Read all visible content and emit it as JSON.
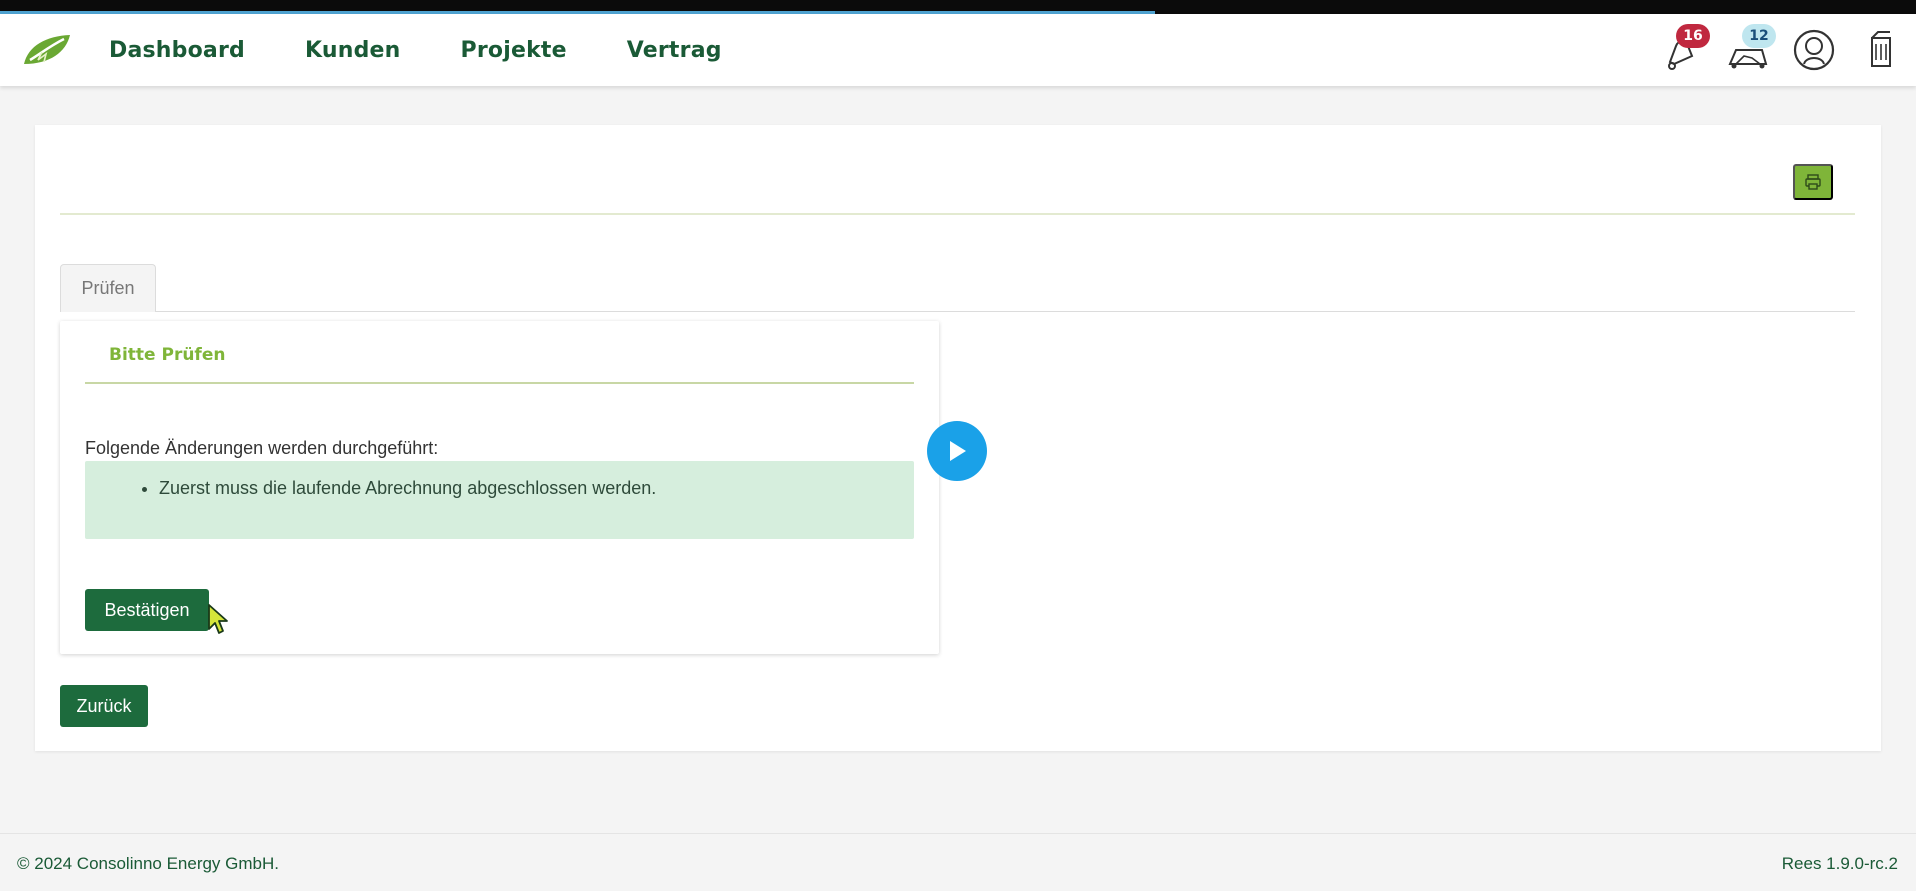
{
  "nav": {
    "items": [
      {
        "label": "Dashboard"
      },
      {
        "label": "Kunden"
      },
      {
        "label": "Projekte"
      },
      {
        "label": "Vertrag"
      }
    ],
    "icons": [
      {
        "name": "notification-bell-icon",
        "badge": "16",
        "badge_color": "#c0283f"
      },
      {
        "name": "messages-icon",
        "badge": "12",
        "badge_color": "#bfe6ef"
      },
      {
        "name": "user-profile-icon"
      },
      {
        "name": "logout-icon"
      }
    ]
  },
  "tabs": [
    {
      "label": "Prüfen"
    }
  ],
  "panel": {
    "title": "Bitte Prüfen",
    "changes_label": "Folgende Änderungen werden durchgeführt:",
    "changes": [
      "Zuerst muss die laufende Abrechnung abgeschlossen werden."
    ],
    "confirm_label": "Bestätigen"
  },
  "back_label": "Zurück",
  "footer": {
    "copyright": "© 2024 Consolinno Energy GmbH.",
    "version": "Rees 1.9.0-rc.2"
  },
  "colors": {
    "primary_green": "#1d6b3d",
    "accent_green": "#7fb539",
    "info_bg": "#d6eedd",
    "play_blue": "#1aa1e8"
  }
}
